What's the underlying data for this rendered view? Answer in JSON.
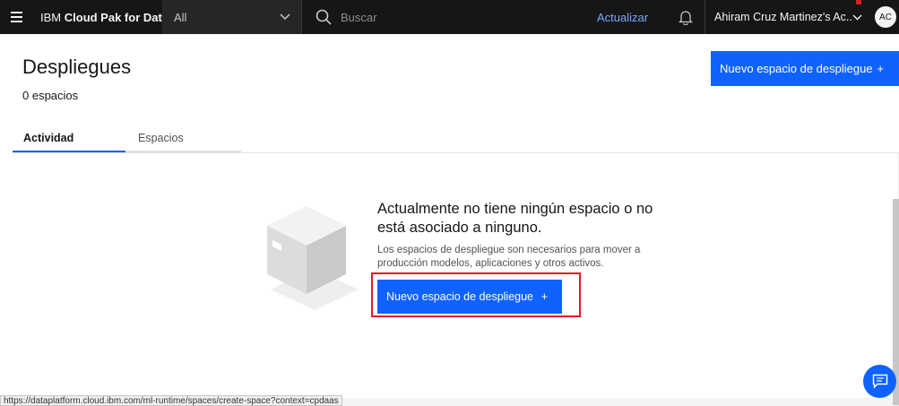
{
  "header": {
    "brand_prefix": "IBM",
    "brand_name": "Cloud Pak for Data",
    "scope_value": "All",
    "search_placeholder": "Buscar",
    "upgrade_label": "Actualizar",
    "account_name": "Ahiram Cruz Martinez's Ac...",
    "avatar_initials": "AC",
    "icons": [
      "menu-icon",
      "chevron-down-icon",
      "search-icon",
      "bell-icon",
      "chevron-down-icon"
    ]
  },
  "page": {
    "title": "Despliegues",
    "count": "0 espacios",
    "primary_button": "Nuevo espacio de despliegue",
    "primary_button_icon": "+"
  },
  "tabs": [
    {
      "label": "Actividad",
      "active": true
    },
    {
      "label": "Espacios",
      "active": false
    }
  ],
  "empty_state": {
    "title": "Actualmente no tiene ningún espacio o no está asociado a ninguno.",
    "description": "Los espacios de despliegue son necesarios para mover a producción modelos, aplicaciones y otros activos.",
    "button": "Nuevo espacio de despliegue",
    "button_icon": "+"
  },
  "status_bar": {
    "url": "https://dataplatform.cloud.ibm.com/ml-runtime/spaces/create-space?context=cpdaas"
  },
  "colors": {
    "primary": "#0f62fe",
    "header_bg": "#161616",
    "highlight": "#da1e28",
    "link": "#78a9ff"
  }
}
